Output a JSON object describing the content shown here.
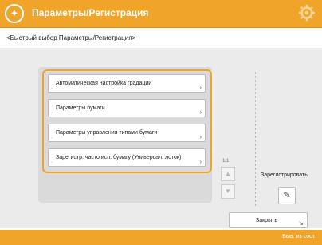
{
  "header": {
    "title": "Параметры/Регистрация"
  },
  "breadcrumb": "<Быстрый выбор Параметры/Регистрация>",
  "menu_items": [
    {
      "label": "Автоматическая настройка градации"
    },
    {
      "label": "Параметры бумаги"
    },
    {
      "label": "Параметры управления типами бумаги"
    },
    {
      "label": "Зарегистр. часто исп. бумагу (Универсал. лоток)"
    }
  ],
  "pager": {
    "page": "1/1"
  },
  "register": {
    "label": "Зарегистрировать"
  },
  "footer": {
    "close_label": "Закрыть",
    "status": "Выв. из сост."
  }
}
